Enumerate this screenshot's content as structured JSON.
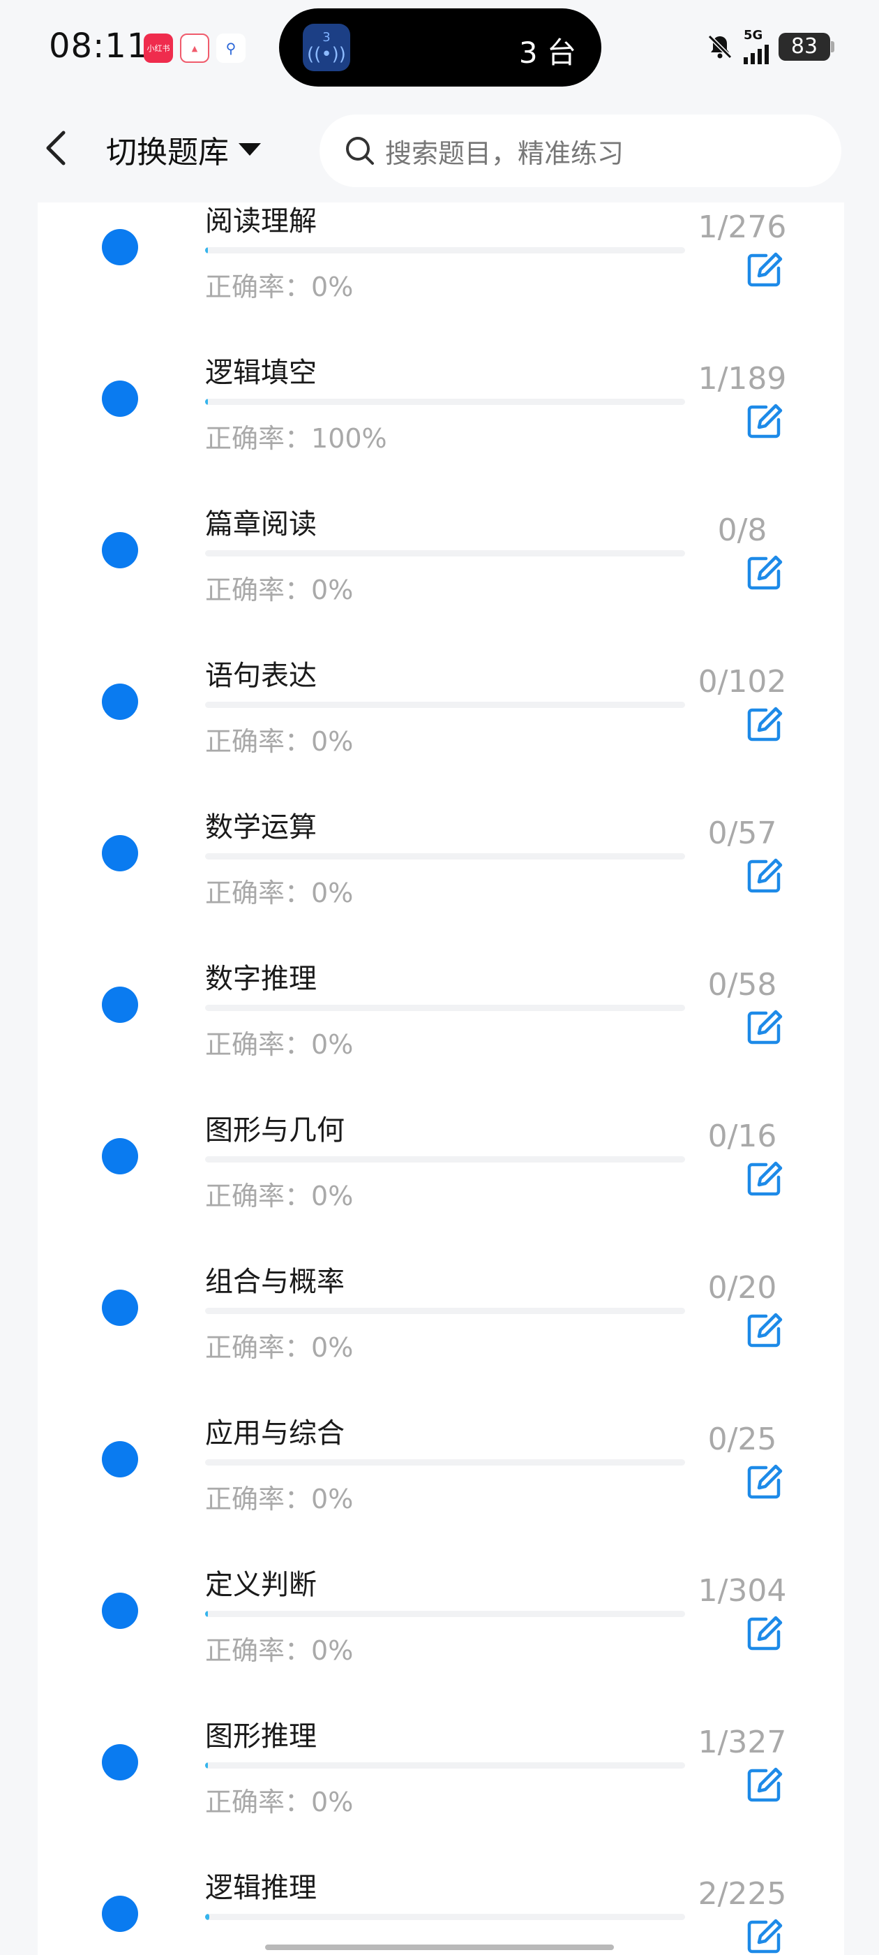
{
  "status": {
    "time": "08:11",
    "app_badges": [
      "小红书",
      "",
      ""
    ],
    "island_icon_count": "3",
    "island_text": "3 台",
    "network": "5G",
    "battery": "83"
  },
  "header": {
    "bank_label": "切换题库",
    "search_placeholder": "搜索题目，精准练习"
  },
  "accuracy_prefix": "正确率：",
  "colors": {
    "dot": "#0a7bf0",
    "edit": "#1d8ae8",
    "progress": "#35b4ec"
  },
  "items": [
    {
      "title": "阅读理解",
      "accuracy": "0%",
      "count": "1/276",
      "progress": 0.0036
    },
    {
      "title": "逻辑填空",
      "accuracy": "100%",
      "count": "1/189",
      "progress": 0.0053
    },
    {
      "title": "篇章阅读",
      "accuracy": "0%",
      "count": "0/8",
      "progress": 0
    },
    {
      "title": "语句表达",
      "accuracy": "0%",
      "count": "0/102",
      "progress": 0
    },
    {
      "title": "数学运算",
      "accuracy": "0%",
      "count": "0/57",
      "progress": 0
    },
    {
      "title": "数字推理",
      "accuracy": "0%",
      "count": "0/58",
      "progress": 0
    },
    {
      "title": "图形与几何",
      "accuracy": "0%",
      "count": "0/16",
      "progress": 0
    },
    {
      "title": "组合与概率",
      "accuracy": "0%",
      "count": "0/20",
      "progress": 0
    },
    {
      "title": "应用与综合",
      "accuracy": "0%",
      "count": "0/25",
      "progress": 0
    },
    {
      "title": "定义判断",
      "accuracy": "0%",
      "count": "1/304",
      "progress": 0.0033
    },
    {
      "title": "图形推理",
      "accuracy": "0%",
      "count": "1/327",
      "progress": 0.0031
    },
    {
      "title": "逻辑推理",
      "accuracy": "",
      "count": "2/225",
      "progress": 0.0089
    }
  ]
}
